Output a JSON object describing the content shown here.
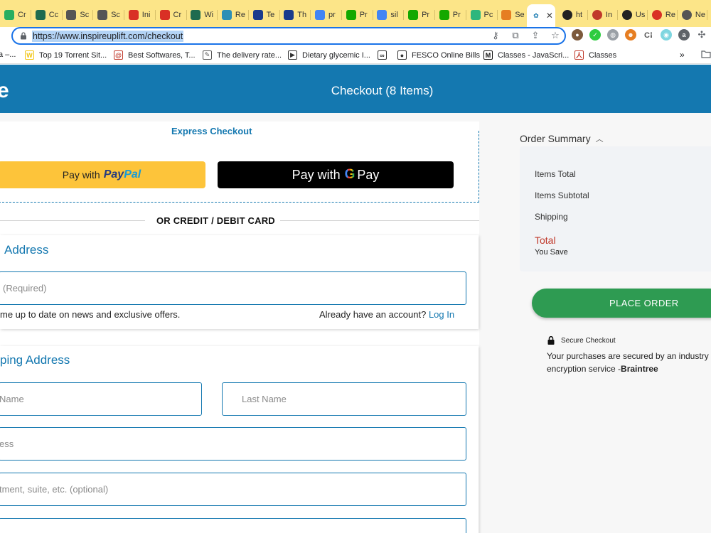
{
  "browser": {
    "tabs": [
      {
        "label": "Cr",
        "icon": "leaf-icon",
        "color": "#27ae60"
      },
      {
        "label": "Cc",
        "icon": "c-icon",
        "color": "#1e6b4f"
      },
      {
        "label": "Sc",
        "icon": "globe-icon",
        "color": "#555555"
      },
      {
        "label": "Sc",
        "icon": "globe-icon",
        "color": "#555555"
      },
      {
        "label": "Ini",
        "icon": "gmail-icon",
        "color": "#d93025"
      },
      {
        "label": "Cr",
        "icon": "gmail-icon",
        "color": "#d93025"
      },
      {
        "label": "Wi",
        "icon": "c-icon",
        "color": "#1e6b4f"
      },
      {
        "label": "Re",
        "icon": "diamond-icon",
        "color": "#2d8fb5"
      },
      {
        "label": "Te",
        "icon": "uol-icon",
        "color": "#1a3c8c"
      },
      {
        "label": "Th",
        "icon": "uol-icon",
        "color": "#1a3c8c"
      },
      {
        "label": "pr",
        "icon": "google-icon",
        "color": "#4285f4"
      },
      {
        "label": "Pr",
        "icon": "upwork-icon",
        "color": "#14a800"
      },
      {
        "label": "sil",
        "icon": "google-icon",
        "color": "#4285f4"
      },
      {
        "label": "Pr",
        "icon": "upwork-icon",
        "color": "#14a800"
      },
      {
        "label": "Pr",
        "icon": "upwork-icon",
        "color": "#14a800"
      },
      {
        "label": "Pc",
        "icon": "slack-icon",
        "color": "#2eb67d"
      },
      {
        "label": "Se",
        "icon": "flame-icon",
        "color": "#e67e22"
      }
    ],
    "active_tab": {
      "icon": "inspire-icon",
      "close": "✕"
    },
    "tabs_after": [
      {
        "label": "ht",
        "icon": "k-icon",
        "color": "#222222"
      },
      {
        "label": "In",
        "icon": "m-icon",
        "color": "#c0392b"
      },
      {
        "label": "Us",
        "icon": "react-icon",
        "color": "#222222"
      },
      {
        "label": "Re",
        "icon": "v-icon",
        "color": "#d93025"
      },
      {
        "label": "Ne",
        "icon": "globe-icon",
        "color": "#555555"
      }
    ],
    "url": "https://www.inspireuplift.com/checkout",
    "bookmarks": [
      {
        "label": "a –..."
      },
      {
        "label": "Top 19 Torrent Sit...",
        "icon_color": "#f1c40f",
        "icon_text": "W"
      },
      {
        "label": "Best Softwares, T...",
        "icon_color": "#c0392b",
        "icon_text": "@"
      },
      {
        "label": "The delivery rate...",
        "icon_color": "#555555",
        "icon_text": "✎"
      },
      {
        "label": "Dietary glycemic I...",
        "icon_color": "#333333",
        "icon_text": "▶"
      },
      {
        "label": "",
        "icon_color": "#333333",
        "icon_text": "∞"
      },
      {
        "label": "FESCO Online Bills",
        "icon_color": "#333333",
        "icon_text": "●"
      },
      {
        "label": "Classes - JavaScri...",
        "icon_color": "#111111",
        "icon_text": "M"
      },
      {
        "label": "Classes",
        "icon_color": "#c0392b",
        "icon_text": "人"
      }
    ],
    "bookmarks_more": "»"
  },
  "header": {
    "logo_fragment": "e",
    "title": "Checkout (8 Items)"
  },
  "express": {
    "label": "Express Checkout",
    "paypal_prefix": "Pay with",
    "paypal_brand_1": "Pay",
    "paypal_brand_2": "Pal",
    "gpay_prefix": "Pay with",
    "gpay_g": "G",
    "gpay_suffix": "Pay"
  },
  "divider": {
    "label": "OR CREDIT / DEBIT CARD"
  },
  "contact": {
    "title": "Address",
    "email_placeholder": "(Required)",
    "newsletter_text": "me up to date on news and exclusive offers.",
    "account_prompt": "Already have an account?",
    "login_link": "Log In"
  },
  "shipping": {
    "title": "ping Address",
    "first_name_placeholder": "Name",
    "last_name_placeholder": "Last Name",
    "address_placeholder": "ess",
    "apartment_placeholder": "tment, suite, etc. (optional)"
  },
  "summary": {
    "title": "Order Summary",
    "chevron": "︿",
    "items_total": "Items Total",
    "items_subtotal": "Items Subtotal",
    "shipping": "Shipping",
    "total": "Total",
    "you_save": "You Save"
  },
  "place_order": {
    "label": "PLACE ORDER"
  },
  "secure": {
    "title": "Secure Checkout",
    "body": "Your purchases are secured by an industry encryption service -",
    "brand": "Braintree"
  },
  "colors": {
    "brand_blue": "#1478b0",
    "place_order_green": "#2e9b52",
    "paypal_yellow": "#fdc43a",
    "total_red": "#c0392b",
    "tabstrip_yellow": "#fce588"
  }
}
